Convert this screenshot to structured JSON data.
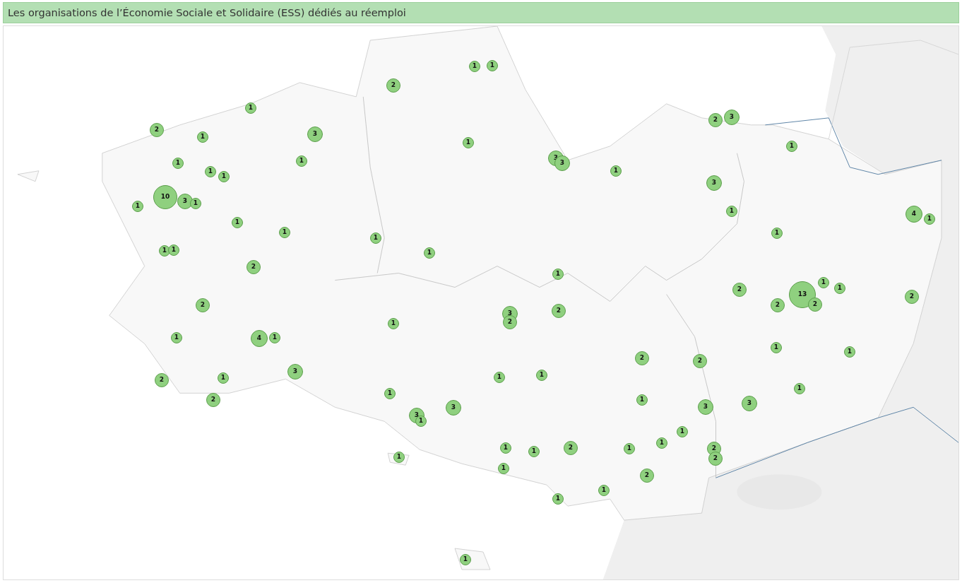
{
  "title": "Les organisations de l’Économie Sociale et Solidaire (ESS) dédiés au réemploi",
  "map": {
    "markers": [
      {
        "count": "1"
      },
      {
        "count": "1"
      },
      {
        "count": "2"
      },
      {
        "count": "1"
      },
      {
        "count": "2"
      },
      {
        "count": "1"
      },
      {
        "count": "3"
      },
      {
        "count": "1"
      },
      {
        "count": "2"
      },
      {
        "count": "3"
      },
      {
        "count": "1"
      },
      {
        "count": "1"
      },
      {
        "count": "1"
      },
      {
        "count": "1"
      },
      {
        "count": "1"
      },
      {
        "count": "3"
      },
      {
        "count": "3"
      },
      {
        "count": "1"
      },
      {
        "count": "3"
      },
      {
        "count": "10"
      },
      {
        "count": "3"
      },
      {
        "count": "1"
      },
      {
        "count": "1"
      },
      {
        "count": "1"
      },
      {
        "count": "4"
      },
      {
        "count": "1"
      },
      {
        "count": "1"
      },
      {
        "count": "1"
      },
      {
        "count": "1"
      },
      {
        "count": "1"
      },
      {
        "count": "1"
      },
      {
        "count": "1"
      },
      {
        "count": "1"
      },
      {
        "count": "2"
      },
      {
        "count": "1"
      },
      {
        "count": "2"
      },
      {
        "count": "1"
      },
      {
        "count": "1"
      },
      {
        "count": "13"
      },
      {
        "count": "2"
      },
      {
        "count": "2"
      },
      {
        "count": "2"
      },
      {
        "count": "2"
      },
      {
        "count": "3"
      },
      {
        "count": "2"
      },
      {
        "count": "2"
      },
      {
        "count": "1"
      },
      {
        "count": "1"
      },
      {
        "count": "4"
      },
      {
        "count": "1"
      },
      {
        "count": "1"
      },
      {
        "count": "1"
      },
      {
        "count": "2"
      },
      {
        "count": "2"
      },
      {
        "count": "3"
      },
      {
        "count": "2"
      },
      {
        "count": "1"
      },
      {
        "count": "1"
      },
      {
        "count": "1"
      },
      {
        "count": "1"
      },
      {
        "count": "1"
      },
      {
        "count": "2"
      },
      {
        "count": "1"
      },
      {
        "count": "3"
      },
      {
        "count": "3"
      },
      {
        "count": "3"
      },
      {
        "count": "3"
      },
      {
        "count": "1"
      },
      {
        "count": "1"
      },
      {
        "count": "1"
      },
      {
        "count": "1"
      },
      {
        "count": "1"
      },
      {
        "count": "2"
      },
      {
        "count": "1"
      },
      {
        "count": "2"
      },
      {
        "count": "2"
      },
      {
        "count": "1"
      },
      {
        "count": "1"
      },
      {
        "count": "2"
      },
      {
        "count": "1"
      },
      {
        "count": "1"
      },
      {
        "count": "1"
      }
    ]
  }
}
